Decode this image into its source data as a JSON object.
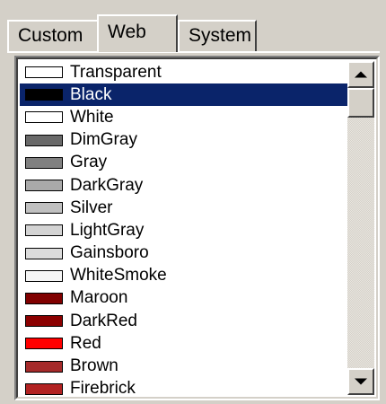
{
  "tabs": [
    {
      "label": "Custom",
      "active": false
    },
    {
      "label": "Web",
      "active": true
    },
    {
      "label": "System",
      "active": false
    }
  ],
  "colors": [
    {
      "name": "Transparent",
      "swatch": "#ffffff",
      "selected": false
    },
    {
      "name": "Black",
      "swatch": "#000000",
      "selected": true
    },
    {
      "name": "White",
      "swatch": "#ffffff",
      "selected": false
    },
    {
      "name": "DimGray",
      "swatch": "#696969",
      "selected": false
    },
    {
      "name": "Gray",
      "swatch": "#808080",
      "selected": false
    },
    {
      "name": "DarkGray",
      "swatch": "#a9a9a9",
      "selected": false
    },
    {
      "name": "Silver",
      "swatch": "#c0c0c0",
      "selected": false
    },
    {
      "name": "LightGray",
      "swatch": "#d3d3d3",
      "selected": false
    },
    {
      "name": "Gainsboro",
      "swatch": "#dcdcdc",
      "selected": false
    },
    {
      "name": "WhiteSmoke",
      "swatch": "#f5f5f5",
      "selected": false
    },
    {
      "name": "Maroon",
      "swatch": "#800000",
      "selected": false
    },
    {
      "name": "DarkRed",
      "swatch": "#8b0000",
      "selected": false
    },
    {
      "name": "Red",
      "swatch": "#ff0000",
      "selected": false
    },
    {
      "name": "Brown",
      "swatch": "#a52a2a",
      "selected": false
    },
    {
      "name": "Firebrick",
      "swatch": "#b22222",
      "selected": false
    }
  ],
  "theme": {
    "selection_bg": "#0a246a",
    "selection_fg": "#ffffff",
    "face": "#d4d0c8"
  }
}
